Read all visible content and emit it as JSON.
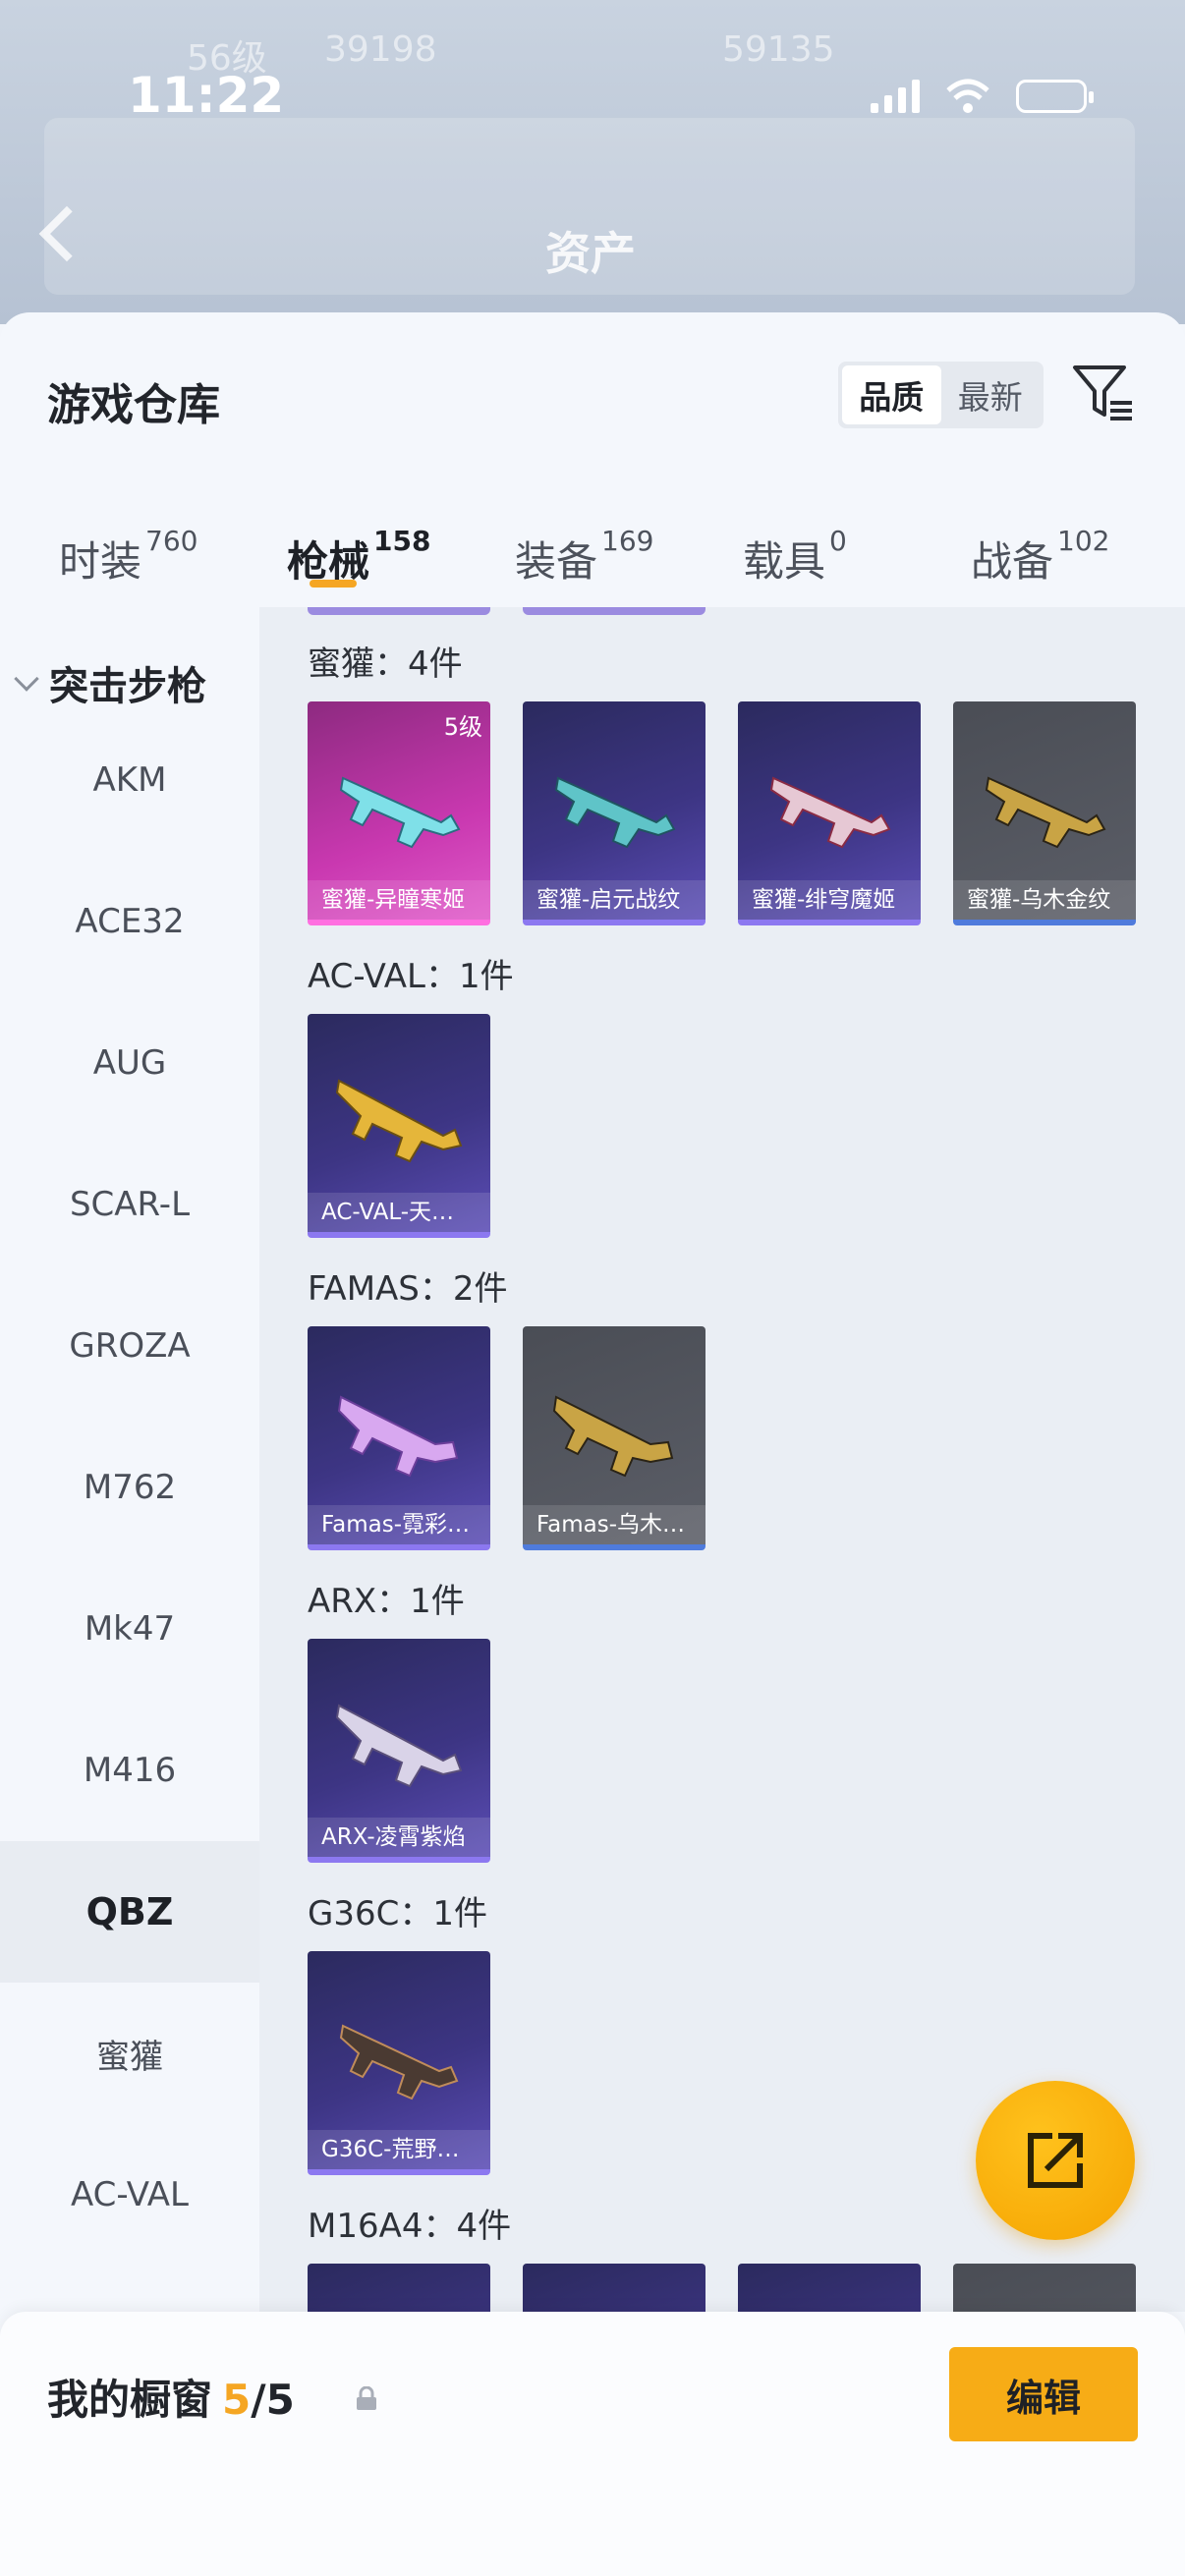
{
  "status_bar": {
    "time": "11:22"
  },
  "background": {
    "title": "资产",
    "ghost_level": "56级",
    "ghost_number1": "39198",
    "ghost_number2": "59135"
  },
  "sheet": {
    "title": "游戏仓库",
    "sort": {
      "quality": "品质",
      "newest": "最新"
    }
  },
  "tabs": [
    {
      "label": "时装",
      "count": "760"
    },
    {
      "label": "枪械",
      "count": "158"
    },
    {
      "label": "装备",
      "count": "169"
    },
    {
      "label": "载具",
      "count": "0"
    },
    {
      "label": "战备",
      "count": "102"
    }
  ],
  "sidebar": {
    "category": "突击步枪",
    "items": [
      "AKM",
      "ACE32",
      "AUG",
      "SCAR-L",
      "GROZA",
      "M762",
      "Mk47",
      "M416",
      "QBZ",
      "蜜獾",
      "AC-VAL"
    ]
  },
  "groups": [
    {
      "title": "蜜獾：4件",
      "cards": [
        {
          "label": "蜜獾-异瞳寒姬",
          "level": "5级",
          "rarity": "pink"
        },
        {
          "label": "蜜獾-启元战纹",
          "rarity": "purple"
        },
        {
          "label": "蜜獾-绯穹魔姬",
          "rarity": "purple"
        },
        {
          "label": "蜜獾-乌木金纹",
          "rarity": "gray"
        }
      ]
    },
    {
      "title": "AC-VAL：1件",
      "cards": [
        {
          "label": "AC-VAL-天…",
          "rarity": "purple"
        }
      ]
    },
    {
      "title": "FAMAS：2件",
      "cards": [
        {
          "label": "Famas-霓彩…",
          "rarity": "purple"
        },
        {
          "label": "Famas-乌木…",
          "rarity": "gray"
        }
      ]
    },
    {
      "title": "ARX：1件",
      "cards": [
        {
          "label": "ARX-凌霄紫焰",
          "rarity": "purple"
        }
      ]
    },
    {
      "title": "G36C：1件",
      "cards": [
        {
          "label": "G36C-荒野…",
          "rarity": "purple"
        }
      ]
    },
    {
      "title": "M16A4：4件",
      "cards": []
    }
  ],
  "bottom": {
    "title": "我的橱窗",
    "current": "5",
    "total": "/5",
    "edit_label": "编辑"
  },
  "colors": {
    "accent": "#f5a623",
    "purple_card": "#3d3584",
    "pink_card": "#c938b0",
    "gray_card": "#5b5e67"
  }
}
